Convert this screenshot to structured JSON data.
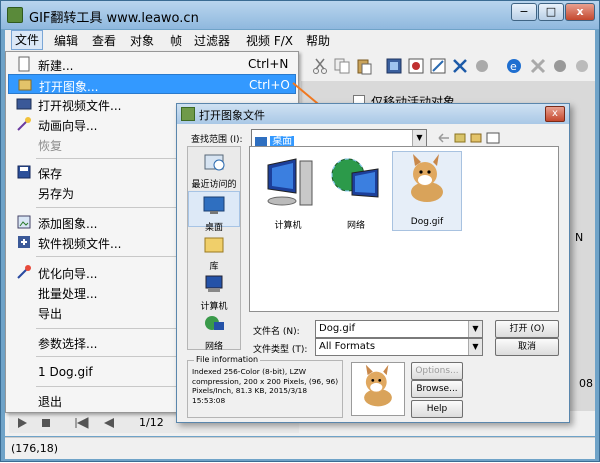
{
  "window": {
    "title": "GIF翻转工具 www.leawo.cn",
    "min": "−",
    "max": "□",
    "close": "x"
  },
  "menubar": [
    "文件",
    "编辑",
    "查看",
    "对象",
    "帧",
    "过滤器",
    "视频 F/X",
    "帮助"
  ],
  "file_menu": {
    "items": [
      {
        "label": "新建...",
        "shortcut": "Ctrl+N"
      },
      {
        "label": "打开图象...",
        "shortcut": "Ctrl+O"
      },
      {
        "label": "打开视频文件..."
      },
      {
        "label": "动画向导..."
      },
      {
        "label": "恢复"
      },
      {
        "label": "保存"
      },
      {
        "label": "另存为"
      },
      {
        "label": "添加图象..."
      },
      {
        "label": "软件视频文件..."
      },
      {
        "label": "优化向导..."
      },
      {
        "label": "批量处理..."
      },
      {
        "label": "导出"
      },
      {
        "label": "参数选择..."
      },
      {
        "label": "1 Dog.gif"
      },
      {
        "label": "退出"
      }
    ]
  },
  "right_panel": {
    "checkbox_label": "仅移动活动对象",
    "marker_a": "N",
    "marker_b": "08"
  },
  "status": {
    "coords": "(176,18)",
    "frame_counter": "1/12"
  },
  "dialog": {
    "title": "打开图象文件",
    "look_in_label": "查找范围 (I):",
    "look_in_value": "桌面",
    "places": [
      "最近访问的位置",
      "桌面",
      "库",
      "计算机",
      "网络"
    ],
    "files": [
      "计算机",
      "网络",
      "Dog.gif"
    ],
    "filename_label": "文件名 (N):",
    "filename_value": "Dog.gif",
    "filetype_label": "文件类型 (T):",
    "filetype_value": "All Formats",
    "open_button": "打开 (O)",
    "cancel_button": "取消",
    "fileinfo_legend": "File information",
    "fileinfo_text": "Indexed 256-Color (8-bit), LZW compression, 200 x 200 Pixels, (96, 96) Pixels/Inch, 81.3 KB, 2015/3/18 15:53:08",
    "options_button": "Options...",
    "browse_button": "Browse...",
    "help_button": "Help"
  },
  "colors": {
    "highlight": "#3399ff",
    "arrow": "#f07820",
    "title_gradient_top": "#b9d5ee"
  }
}
